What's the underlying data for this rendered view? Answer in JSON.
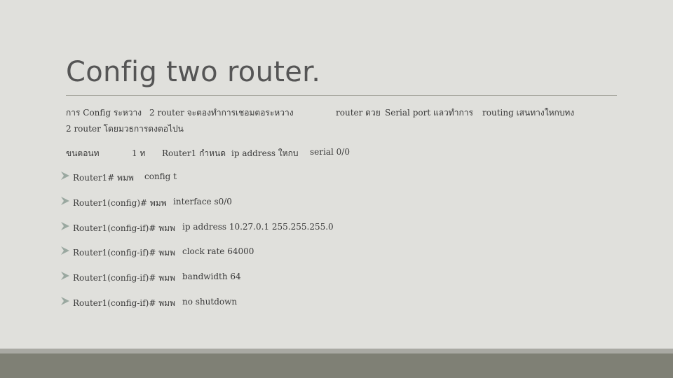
{
  "slide": {
    "title": "Config two router.",
    "intro": {
      "line1_a": "การ Config ระหวาง",
      "line1_b": "2 router จะตองทำการเชอมตอระหวาง",
      "line1_c": "router ดวย",
      "line1_d": "Serial port แลวทำการ",
      "line1_e": "routing เสนทางใหกบทง",
      "line2": "2 router โดยมวธการดงตอไปน"
    },
    "step": {
      "a": "ขนตอนท",
      "b": "1 ท",
      "c": "Router1 กำหนด",
      "d": "ip address ใหกบ",
      "e": "serial 0/0"
    },
    "commands": [
      {
        "prompt": "Router1# พมพ",
        "command": "config t"
      },
      {
        "prompt": "Router1(config)# พมพ",
        "command": "interface s0/0"
      },
      {
        "prompt": "Router1(config-if)# พมพ",
        "command": "ip address 10.27.0.1 255.255.255.0"
      },
      {
        "prompt": "Router1(config-if)# พมพ",
        "command": "clock rate 64000"
      },
      {
        "prompt": "Router1(config-if)# พมพ",
        "command": "bandwidth 64"
      },
      {
        "prompt": "Router1(config-if)# พมพ",
        "command": "no shutdown"
      }
    ],
    "bullet_icon": "arrowhead-bullet-icon",
    "colors": {
      "background": "#e0e0dc",
      "footer": "#7f8075",
      "footer_stripe": "#a9a9a3",
      "bullet": "#9aa8a0"
    }
  }
}
